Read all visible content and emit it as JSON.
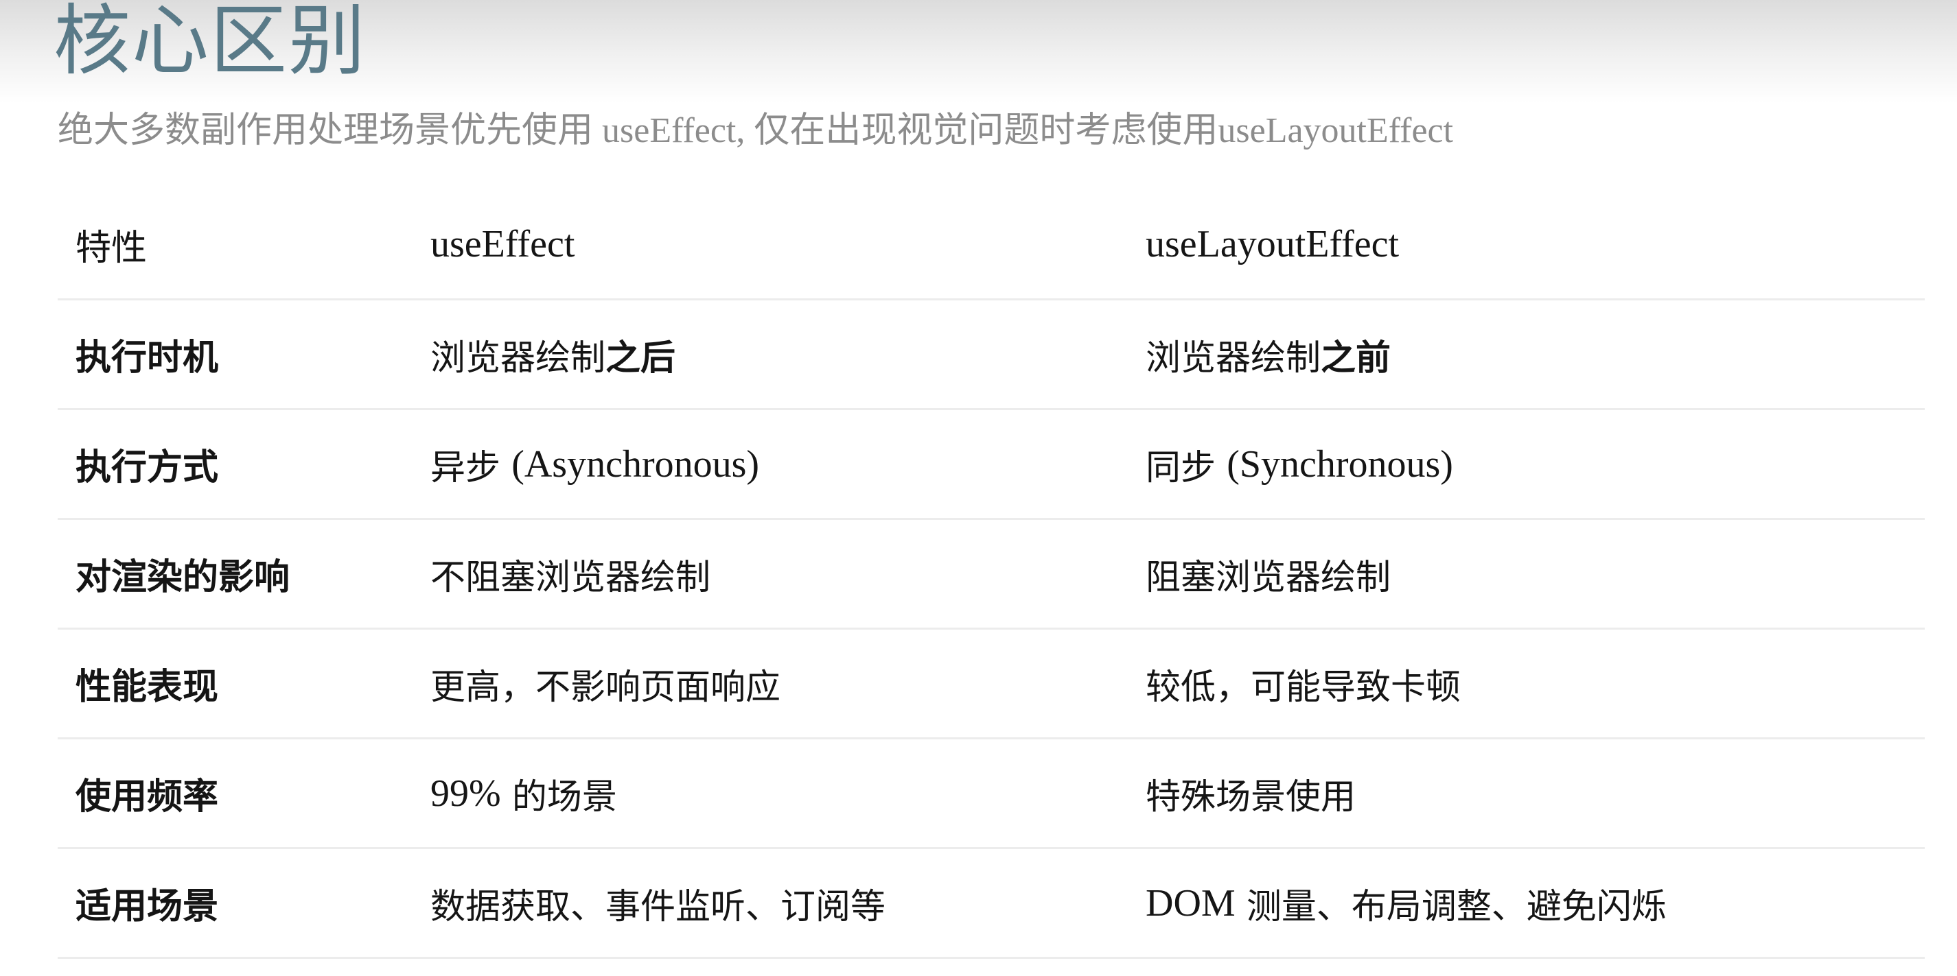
{
  "title": "核心区别",
  "subtitle": "绝大多数副作用处理场景优先使用 useEffect, 仅在出现视觉问题时考虑使用useLayoutEffect",
  "table": {
    "headers": [
      "特性",
      "useEffect",
      "useLayoutEffect"
    ],
    "rows": [
      {
        "feature": "执行时机",
        "use_effect": [
          "浏览器绘制",
          "之后"
        ],
        "use_layout_effect": [
          "浏览器绘制",
          "之前"
        ]
      },
      {
        "feature": "执行方式",
        "use_effect": [
          "异步 ",
          "(Asynchronous)"
        ],
        "use_layout_effect": [
          "同步 ",
          "(Synchronous)"
        ]
      },
      {
        "feature": "对渲染的影响",
        "use_effect": "不阻塞浏览器绘制",
        "use_layout_effect": "阻塞浏览器绘制"
      },
      {
        "feature": "性能表现",
        "use_effect": "更高，不影响页面响应",
        "use_layout_effect": "较低，可能导致卡顿"
      },
      {
        "feature": "使用频率",
        "use_effect": [
          "99%",
          " 的场景"
        ],
        "use_layout_effect": "特殊场景使用"
      },
      {
        "feature": "适用场景",
        "use_effect": "数据获取、事件监听、订阅等",
        "use_layout_effect": [
          "DOM",
          " 测量、布局调整、避免闪烁"
        ]
      }
    ]
  },
  "colors": {
    "title": "#597a88",
    "subtitle": "#8c8c8c",
    "text": "#151515",
    "divider": "#ececec"
  }
}
